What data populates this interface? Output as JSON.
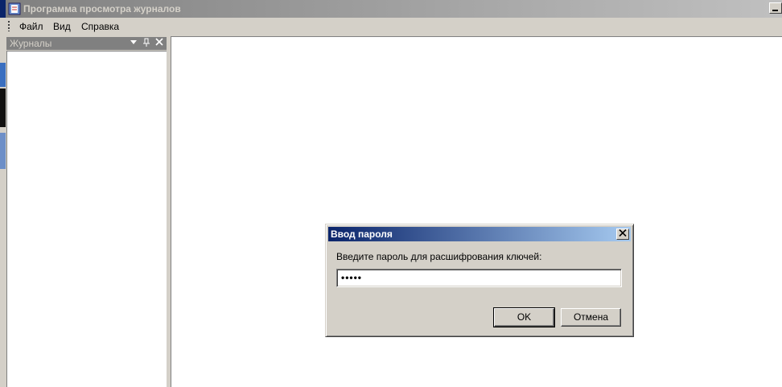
{
  "window": {
    "title": "Программа просмотра журналов"
  },
  "menu": {
    "items": [
      "Файл",
      "Вид",
      "Справка"
    ]
  },
  "panel": {
    "title": "Журналы",
    "buttons": [
      "dropdown-icon",
      "pin-icon",
      "close-icon"
    ]
  },
  "dialog": {
    "title": "Ввод пароля",
    "prompt": "Введите пароль для расшифрования ключей:",
    "password_value": "•••••",
    "ok_label": "OK",
    "cancel_label": "Отмена",
    "close_glyph": "✕"
  },
  "colors": {
    "dialog_title_gradient_start": "#0a246a",
    "dialog_title_gradient_end": "#a6caf0",
    "inactive_title": "#808080",
    "face": "#d4d0c8"
  }
}
